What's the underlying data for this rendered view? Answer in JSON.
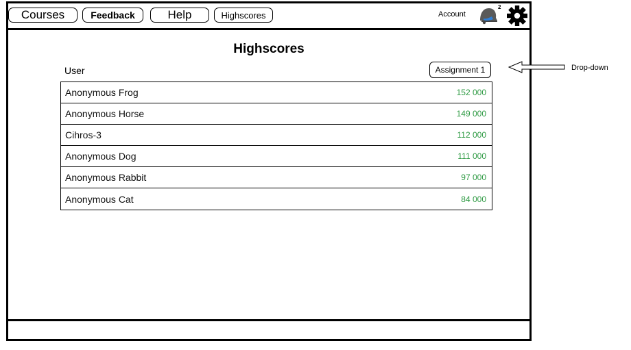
{
  "nav": {
    "courses": "Courses",
    "feedback": "Feedback",
    "help": "Help",
    "highscores": "Highscores"
  },
  "account": {
    "label": "Account",
    "notification_count": "2",
    "notification_icon": "bell-icon",
    "settings_icon": "gear-icon"
  },
  "page": {
    "title": "Highscores",
    "user_header": "User",
    "dropdown_value": "Assignment 1"
  },
  "scores": [
    {
      "name": "Anonymous Frog",
      "score": "152 000"
    },
    {
      "name": "Anonymous Horse",
      "score": "149 000"
    },
    {
      "name": "Cihros-3",
      "score": "112 000"
    },
    {
      "name": "Anonymous Dog",
      "score": "111 000"
    },
    {
      "name": "Anonymous Rabbit",
      "score": "97 000"
    },
    {
      "name": "Anonymous Cat",
      "score": "84 000"
    }
  ],
  "annotation": {
    "label": "Drop-down"
  },
  "colors": {
    "score": "#2e9a43",
    "bell": "#5a5a5a",
    "bell_accent": "#2f7fd6"
  }
}
